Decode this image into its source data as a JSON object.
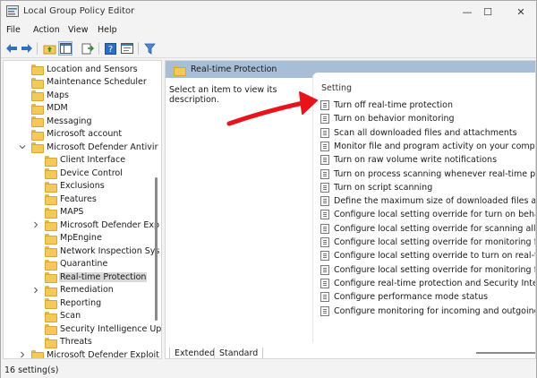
{
  "window": {
    "title": "Local Group Policy Editor",
    "minimize_glyph": "—",
    "maximize_glyph": "☐",
    "close_glyph": "✕"
  },
  "menu": [
    "File",
    "Action",
    "View",
    "Help"
  ],
  "toolbar_icons": [
    "back-arrow-icon",
    "forward-arrow-icon",
    "up-folder-icon",
    "show-hide-tree-icon",
    "export-list-icon",
    "help-icon",
    "properties-icon",
    "filter-icon"
  ],
  "tree": {
    "items": [
      {
        "label": "Location and Sensors",
        "level": 1,
        "expander": ""
      },
      {
        "label": "Maintenance Scheduler",
        "level": 1,
        "expander": ""
      },
      {
        "label": "Maps",
        "level": 1,
        "expander": ""
      },
      {
        "label": "MDM",
        "level": 1,
        "expander": ""
      },
      {
        "label": "Messaging",
        "level": 1,
        "expander": ""
      },
      {
        "label": "Microsoft account",
        "level": 1,
        "expander": ""
      },
      {
        "label": "Microsoft Defender Antivir",
        "level": 1,
        "expander": "expanded"
      },
      {
        "label": "Client Interface",
        "level": 2,
        "expander": ""
      },
      {
        "label": "Device Control",
        "level": 2,
        "expander": ""
      },
      {
        "label": "Exclusions",
        "level": 2,
        "expander": ""
      },
      {
        "label": "Features",
        "level": 2,
        "expander": ""
      },
      {
        "label": "MAPS",
        "level": 2,
        "expander": ""
      },
      {
        "label": "Microsoft Defender Exp",
        "level": 2,
        "expander": "collapsed"
      },
      {
        "label": "MpEngine",
        "level": 2,
        "expander": ""
      },
      {
        "label": "Network Inspection Sys",
        "level": 2,
        "expander": ""
      },
      {
        "label": "Quarantine",
        "level": 2,
        "expander": ""
      },
      {
        "label": "Real-time Protection",
        "level": 2,
        "expander": "",
        "selected": true
      },
      {
        "label": "Remediation",
        "level": 2,
        "expander": "collapsed"
      },
      {
        "label": "Reporting",
        "level": 2,
        "expander": ""
      },
      {
        "label": "Scan",
        "level": 2,
        "expander": ""
      },
      {
        "label": "Security Intelligence Up",
        "level": 2,
        "expander": ""
      },
      {
        "label": "Threats",
        "level": 2,
        "expander": ""
      },
      {
        "label": "Microsoft Defender Exploit",
        "level": 1,
        "expander": "collapsed"
      }
    ]
  },
  "right_pane": {
    "title": "Real-time Protection",
    "description": "Select an item to view its description.",
    "column_header": "Setting",
    "settings": [
      "Turn off real-time protection",
      "Turn on behavior monitoring",
      "Scan all downloaded files and attachments",
      "Monitor file and program activity on your computer",
      "Turn on raw volume write notifications",
      "Turn on process scanning whenever real-time protection is enabled",
      "Turn on script scanning",
      "Define the maximum size of downloaded files and attachments to be scanned",
      "Configure local setting override for turn on behavior monitoring",
      "Configure local setting override for scanning all downloaded files and attachments",
      "Configure local setting override for monitoring file and program activity on your computer",
      "Configure local setting override to turn on real-time protection",
      "Configure local setting override for monitoring for incoming and outgoing file activity",
      "Configure real-time protection and Security Intelligence Updates during OOBE",
      "Configure performance mode status",
      "Configure monitoring for incoming and outgoing file and program activity"
    ]
  },
  "tabs": [
    "Extended",
    "Standard"
  ],
  "status": "16 setting(s)",
  "colors": {
    "annotation_arrow": "#e8141c",
    "header_band": "#a8bdd6",
    "folder": "#f4c95a"
  }
}
